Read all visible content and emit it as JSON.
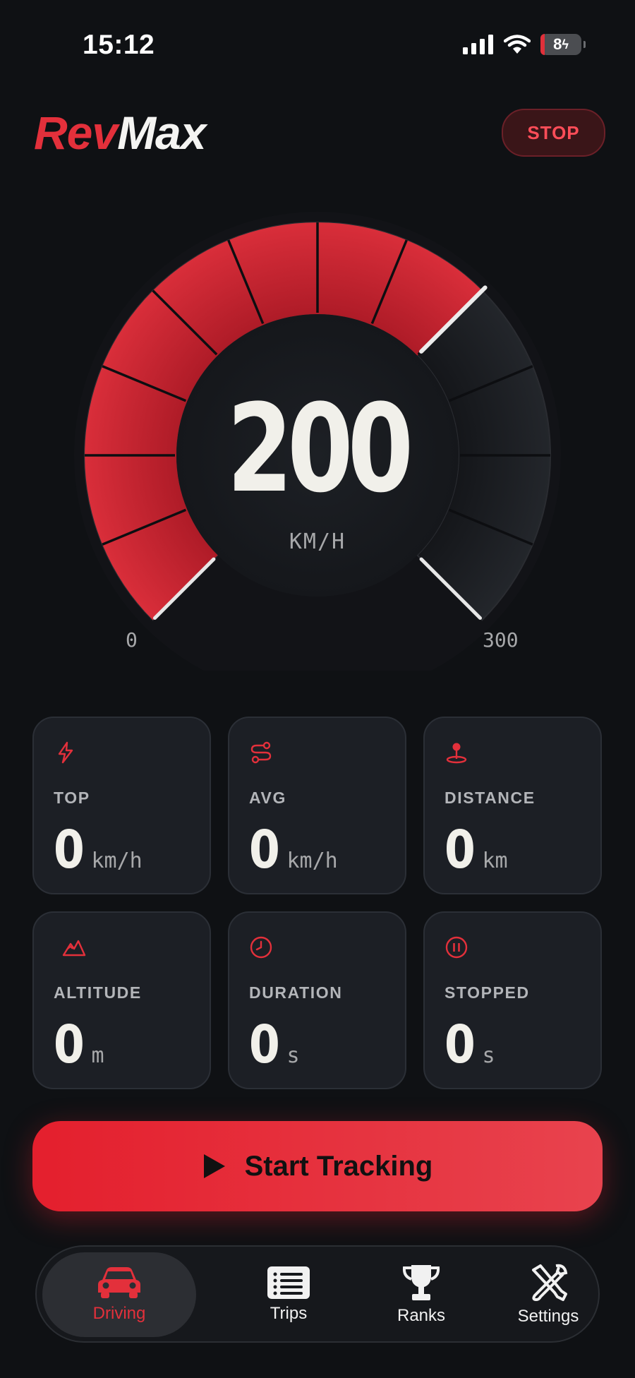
{
  "status": {
    "time": "15:12",
    "battery": "8"
  },
  "header": {
    "logo_rev": "Rev",
    "logo_max": "Max",
    "stop_label": "STOP"
  },
  "gauge": {
    "speed": "200",
    "unit": "KM/H",
    "min_label": "0",
    "max_label": "300",
    "min": 0,
    "max": 300,
    "value": 200,
    "accent": "#e3303b"
  },
  "stats": [
    {
      "icon": "bolt-icon",
      "label": "TOP",
      "value": "0",
      "unit": "km/h"
    },
    {
      "icon": "route-icon",
      "label": "AVG",
      "value": "0",
      "unit": "km/h"
    },
    {
      "icon": "location-pin-icon",
      "label": "DISTANCE",
      "value": "0",
      "unit": "km"
    },
    {
      "icon": "mountain-icon",
      "label": "ALTITUDE",
      "value": "0",
      "unit": "m"
    },
    {
      "icon": "clock-icon",
      "label": "DURATION",
      "value": "0",
      "unit": "s"
    },
    {
      "icon": "pause-icon",
      "label": "STOPPED",
      "value": "0",
      "unit": "s"
    }
  ],
  "start_button": {
    "label": "Start Tracking"
  },
  "tabs": [
    {
      "label": "Driving",
      "icon": "car-icon",
      "active": true
    },
    {
      "label": "Trips",
      "icon": "list-icon",
      "active": false
    },
    {
      "label": "Ranks",
      "icon": "trophy-icon",
      "active": false
    },
    {
      "label": "Settings",
      "icon": "tools-icon",
      "active": false
    }
  ],
  "colors": {
    "background": "#0f1114",
    "accent": "#e3303b",
    "card": "#1c1f25"
  }
}
